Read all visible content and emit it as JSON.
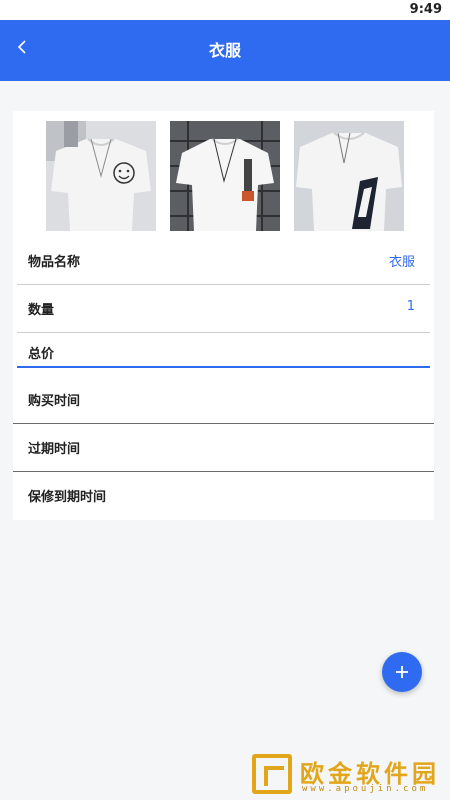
{
  "status_bar": {
    "time": "9:49"
  },
  "app_bar": {
    "title": "衣服"
  },
  "photos": [
    {
      "icon": "tshirt-photo-smiley"
    },
    {
      "icon": "tshirt-photo-necklace"
    },
    {
      "icon": "tshirt-photo-print"
    }
  ],
  "fields": {
    "name": {
      "label": "物品名称",
      "value": "衣服"
    },
    "quantity": {
      "label": "数量",
      "value": "1"
    },
    "total": {
      "label": "总价",
      "value": ""
    },
    "purchase_time": {
      "label": "购买时间",
      "value": ""
    },
    "expire_time": {
      "label": "过期时间",
      "value": ""
    },
    "warranty_time": {
      "label": "保修到期时间",
      "value": ""
    }
  },
  "fab": {
    "icon": "plus-icon"
  },
  "watermark": {
    "title": "欧金软件园",
    "url": "www.apoujin.com"
  },
  "colors": {
    "accent": "#2f6bf0",
    "background": "#f5f6f8",
    "watermark": "#e2a61a"
  }
}
